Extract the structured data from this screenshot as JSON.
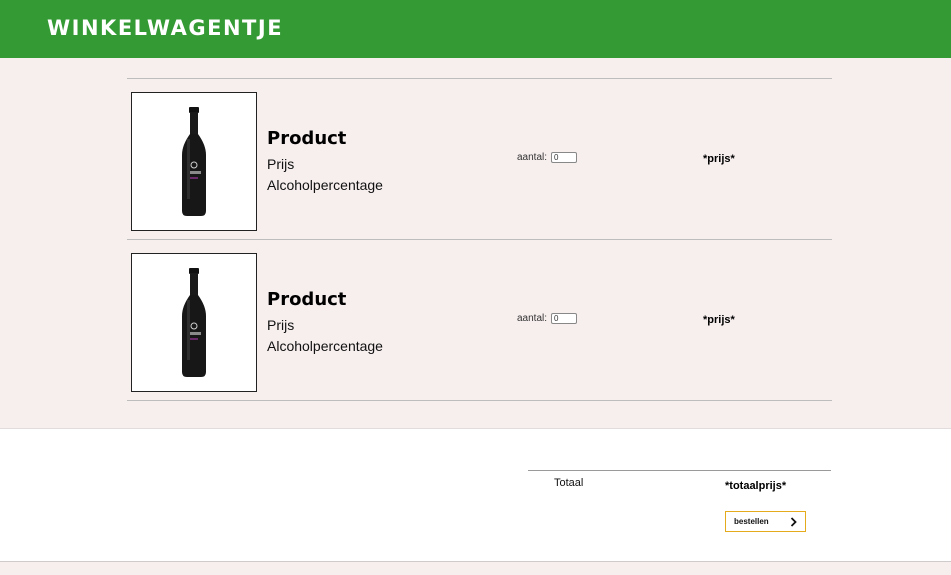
{
  "header": {
    "title": "WINKELWAGENTJE"
  },
  "cart": {
    "items": [
      {
        "name": "Product",
        "price_label": "Prijs",
        "alcohol_label": "Alcoholpercentage",
        "quantity_label": "aantal:",
        "quantity_value": "0",
        "price": "*prijs*",
        "image_icon": "beer-bottle-icon"
      },
      {
        "name": "Product",
        "price_label": "Prijs",
        "alcohol_label": "Alcoholpercentage",
        "quantity_label": "aantal:",
        "quantity_value": "0",
        "price": "*prijs*",
        "image_icon": "beer-bottle-icon"
      }
    ]
  },
  "totals": {
    "label": "Totaal",
    "price": "*totaalprijs*",
    "order_button": "bestellen",
    "order_icon": "chevron-right-icon"
  },
  "colors": {
    "header": "#349a34",
    "background": "#f7eeee",
    "button_border": "#e6ab1d"
  }
}
